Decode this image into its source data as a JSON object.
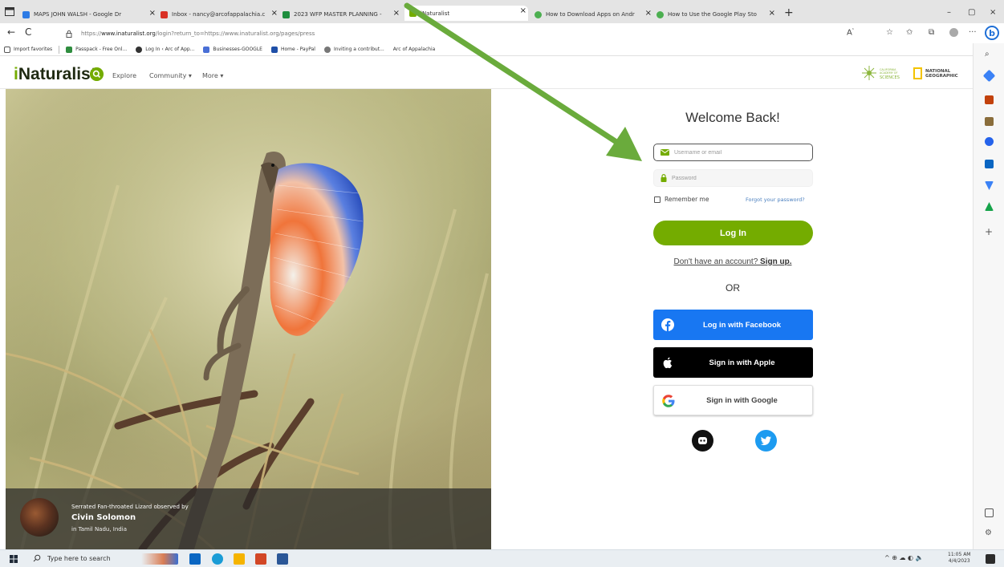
{
  "browser": {
    "tabs": [
      {
        "title": "MAPS JOHN WALSH - Google Dr",
        "icon_color": "#2d7be5",
        "active": false
      },
      {
        "title": "Inbox - nancy@arcofappalachia.c",
        "icon_color": "#d93025",
        "active": false
      },
      {
        "title": "2023 WFP MASTER PLANNING -",
        "icon_color": "#1e8e3e",
        "active": false
      },
      {
        "title": "iNaturalist",
        "icon_color": "#74ac00",
        "active": true
      },
      {
        "title": "How to Download Apps on Andr",
        "icon_color": "#4caf50",
        "active": false
      },
      {
        "title": "How to Use the Google Play Sto",
        "icon_color": "#4caf50",
        "active": false
      }
    ],
    "tab_close_glyph": "×",
    "new_tab_glyph": "+",
    "window_controls": [
      "–",
      "▢",
      "×"
    ],
    "url": "https://www.inaturalist.org/login?return_to=https://www.inaturalist.org/pages/press",
    "url_domain": "www.inaturalist.org",
    "url_scheme": "https://",
    "url_rest": "/login?return_to=https://www.inaturalist.org/pages/press",
    "back_glyph": "←",
    "reload_glyph": "C",
    "bing_label": "b",
    "favorites": [
      {
        "label": "Import favorites",
        "icon_color": "#555555"
      },
      {
        "label": "Passpack - Free Onl...",
        "icon_color": "#2f8d3f"
      },
      {
        "label": "Log In ‹ Arc of App...",
        "icon_color": "#333333"
      },
      {
        "label": "Businesses-GOOGLE",
        "icon_color": "#4a6fd6"
      },
      {
        "label": "Home - PayPal",
        "icon_color": "#1f4fa8"
      },
      {
        "label": "Inviting a contribut...",
        "icon_color": "#777777"
      },
      {
        "label": "Arc of Appalachia",
        "icon_color": "#ffffff"
      }
    ]
  },
  "inat": {
    "logo_i": "i",
    "logo_rest": "Naturalist",
    "nav": [
      "Explore",
      "Community ▾",
      "More ▾"
    ],
    "partners": {
      "cas": "CALIFORNIA ACADEMY OF SCIENCES",
      "natgeo_line1": "NATIONAL",
      "natgeo_line2": "GEOGRAPHIC"
    },
    "accent_color": "#74ac00"
  },
  "hero": {
    "species_line": "Serrated Fan-throated Lizard observed by",
    "observer": "Civin Solomon",
    "place": "in Tamil Nadu, India"
  },
  "login": {
    "title": "Welcome Back!",
    "username_placeholder": "Username or email",
    "password_placeholder": "Password",
    "remember_label": "Remember me",
    "forgot_label": "Forgot your password?",
    "login_button": "Log In",
    "signup_prefix": "Don't have an account? ",
    "signup_link": "Sign up.",
    "or_label": "OR",
    "facebook_label": "Log in with Facebook",
    "apple_label": "Sign in with Apple",
    "google_label": "Sign in with Google"
  },
  "taskbar": {
    "search_placeholder": "Type here to search",
    "time": "11:05 AM",
    "date": "4/4/2023",
    "tray_icons": "^ ⊕ ☁ ◐ 🔈"
  },
  "annotation": {
    "color": "#6aab3c"
  }
}
